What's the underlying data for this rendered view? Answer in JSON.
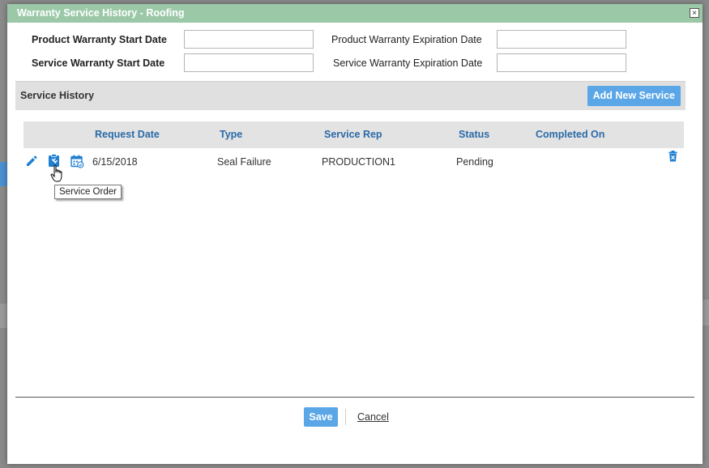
{
  "dialog": {
    "title": "Warranty Service History - Roofing",
    "close_glyph": "×"
  },
  "warranty": {
    "product_start_label": "Product Warranty Start Date",
    "product_start_value": "",
    "product_expiration_label": "Product Warranty Expiration Date",
    "product_expiration_value": "",
    "service_start_label": "Service Warranty Start Date",
    "service_start_value": "",
    "service_expiration_label": "Service Warranty Expiration Date",
    "service_expiration_value": ""
  },
  "service_history": {
    "title": "Service History",
    "add_button": "Add New Service",
    "columns": [
      "Request Date",
      "Type",
      "Service Rep",
      "Status",
      "Completed On"
    ],
    "rows": [
      {
        "request_date": "6/15/2018",
        "type": "Seal Failure",
        "service_rep": "PRODUCTION1",
        "status": "Pending",
        "completed_on": "",
        "icons": [
          "edit-icon",
          "service-order-icon",
          "calendar-icon",
          "trash-icon"
        ]
      }
    ]
  },
  "tooltip": {
    "text": "Service Order"
  },
  "footer": {
    "save_label": "Save",
    "cancel_label": "Cancel"
  },
  "colors": {
    "titlebar": "#9bc9a8",
    "accent": "#5aa6e6",
    "header_text": "#2a6aa8",
    "icon_blue": "#1f7fd1"
  }
}
